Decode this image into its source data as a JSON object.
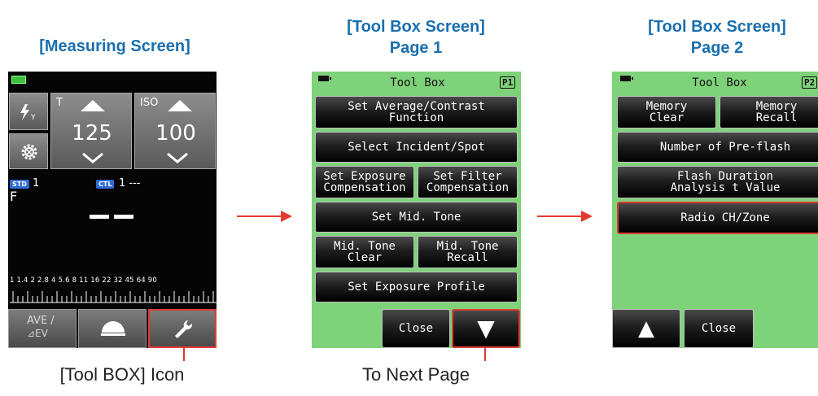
{
  "measuring": {
    "heading": "[Measuring Screen]",
    "t_label": "T",
    "iso_label": "ISO",
    "shutter_value": "125",
    "iso_value": "100",
    "std_badge": "STD",
    "std_count": "1",
    "ctl_badge": "CTL",
    "ctl_value": "1 ---",
    "f_label": "F",
    "reading": "– –",
    "scale_labels": "1 1.4 2 2.8 4 5.6 8 11 16 22 32 45 64 90",
    "ave_label": "AVE /",
    "ev_label": "⊿EV",
    "caption": "[Tool BOX] Icon"
  },
  "page1": {
    "heading_line1": "[Tool Box Screen]",
    "heading_line2": "Page 1",
    "title": "Tool Box",
    "page_badge": "P1",
    "buttons": {
      "average_contrast": "Set Average/Contrast\nFunction",
      "incident_spot": "Select Incident/Spot",
      "exposure_comp": "Set Exposure\nCompensation",
      "filter_comp": "Set Filter\nCompensation",
      "mid_tone": "Set Mid. Tone",
      "mid_tone_clear": "Mid. Tone\nClear",
      "mid_tone_recall": "Mid. Tone\nRecall",
      "exposure_profile": "Set Exposure Profile",
      "close": "Close",
      "next_glyph": "▼"
    },
    "caption": "To Next Page"
  },
  "page2": {
    "heading_line1": "[Tool Box Screen]",
    "heading_line2": "Page 2",
    "title": "Tool Box",
    "page_badge": "P2",
    "buttons": {
      "memory_clear": "Memory\nClear",
      "memory_recall": "Memory\nRecall",
      "pre_flash": "Number of Pre-flash",
      "flash_duration": "Flash Duration\nAnalysis t Value",
      "radio_ch": "Radio CH/Zone",
      "prev_glyph": "▲",
      "close": "Close"
    }
  },
  "colors": {
    "heading": "#1a6fb0",
    "accent_red": "#e23b32",
    "screen_green": "#7ed279"
  },
  "icons": [
    "flash-icon",
    "gear-icon",
    "dome-icon",
    "wrench-icon",
    "battery-icon",
    "chevron-up-icon",
    "chevron-down-icon"
  ]
}
